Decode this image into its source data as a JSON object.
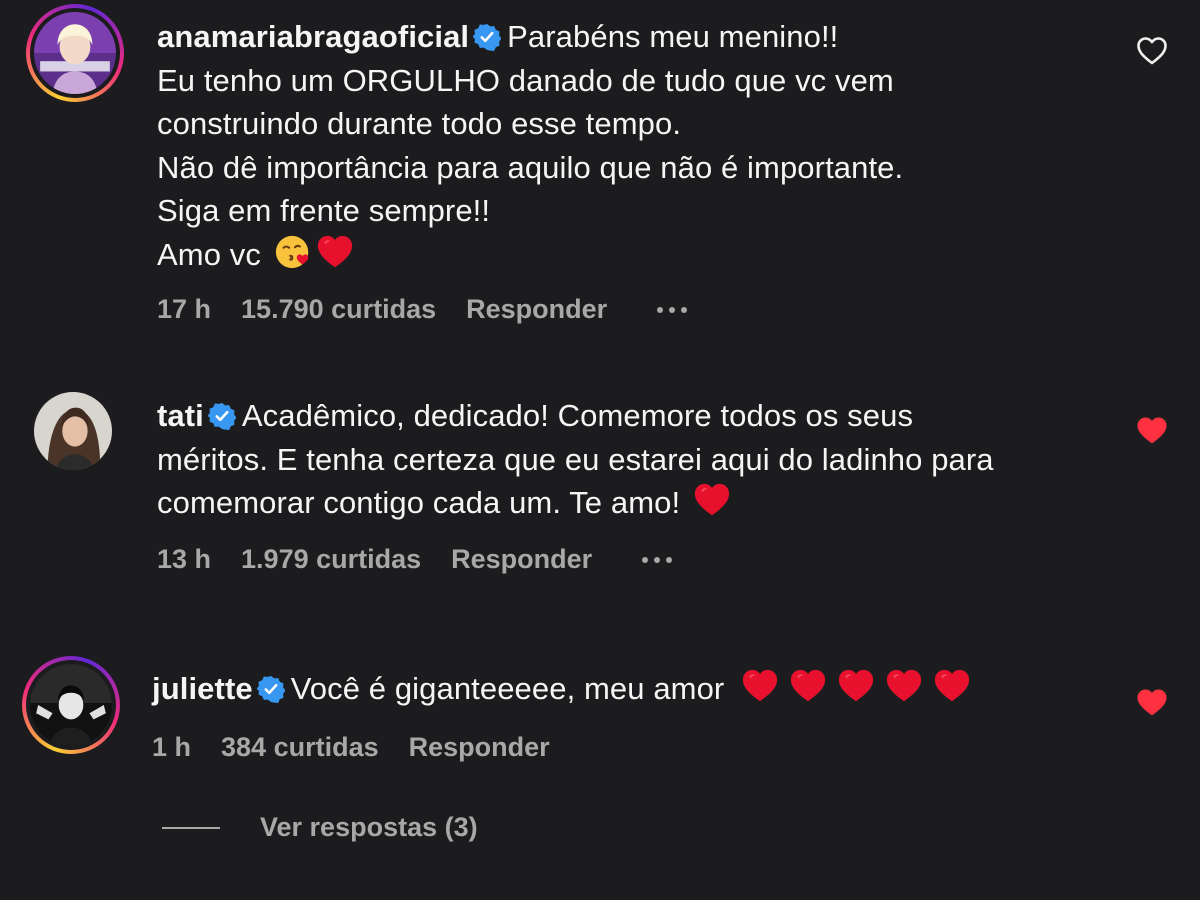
{
  "comments": [
    {
      "username": "anamariabragaoficial",
      "verified": true,
      "lines": [
        "Parabéns meu menino!!",
        "Eu tenho um ORGULHO danado de tudo que vc vem",
        "construindo durante todo esse tempo.",
        "Não dê importância para aquilo que não é importante.",
        "Siga em frente sempre!!",
        "Amo vc"
      ],
      "emojis_last_line": [
        "kissing-face-with-heart-emoji",
        "red-heart-emoji"
      ],
      "time": "17 h",
      "likes": "15.790 curtidas",
      "reply_label": "Responder",
      "liked": false,
      "story_ring": true
    },
    {
      "username": "tati",
      "verified": true,
      "lines": [
        "Acadêmico, dedicado! Comemore todos os seus",
        "méritos. E tenha certeza que eu estarei aqui do ladinho para",
        "comemorar contigo cada um. Te amo!"
      ],
      "emojis_last_line": [
        "red-heart-emoji"
      ],
      "time": "13 h",
      "likes": "1.979 curtidas",
      "reply_label": "Responder",
      "liked": true,
      "story_ring": false
    },
    {
      "username": "juliette",
      "verified": true,
      "lines": [
        "Você é giganteeeee, meu amor"
      ],
      "emojis_last_line": [
        "red-heart-emoji",
        "red-heart-emoji",
        "red-heart-emoji",
        "red-heart-emoji",
        "red-heart-emoji"
      ],
      "time": "1 h",
      "likes": "384 curtidas",
      "reply_label": "Responder",
      "liked": true,
      "story_ring": true
    }
  ],
  "view_replies": "Ver respostas (3)",
  "colors": {
    "background": "#1c1c1e",
    "text": "#f5f5f5",
    "secondary": "#a8a8a8",
    "verified": "#3897f0",
    "liked_heart": "#ff3040"
  }
}
